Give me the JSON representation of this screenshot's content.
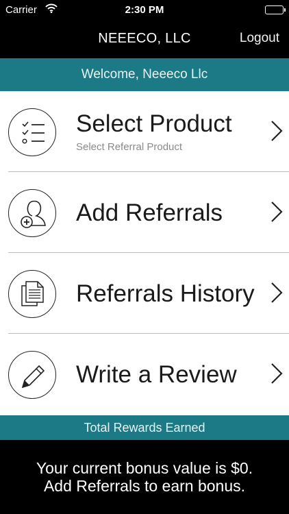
{
  "status_bar": {
    "carrier": "Carrier",
    "time": "2:30 PM",
    "wifi_icon": "wifi-icon",
    "battery_icon": "battery-icon"
  },
  "nav": {
    "title": "NEEECO, LLC",
    "logout": "Logout"
  },
  "welcome": "Welcome, Neeeco Llc",
  "menu": {
    "items": [
      {
        "label": "Select Product",
        "sublabel": "Select Referral Product",
        "icon": "checklist-icon"
      },
      {
        "label": "Add Referrals",
        "icon": "add-user-icon"
      },
      {
        "label": "Referrals History",
        "icon": "documents-icon"
      },
      {
        "label": "Write a Review",
        "icon": "pencil-icon"
      }
    ]
  },
  "rewards": {
    "title": "Total Rewards Earned",
    "line1": "Your current bonus value is $0.",
    "line2": "Add Referrals to earn bonus."
  },
  "colors": {
    "teal": "#1b7a85",
    "black": "#000000",
    "white": "#ffffff"
  }
}
